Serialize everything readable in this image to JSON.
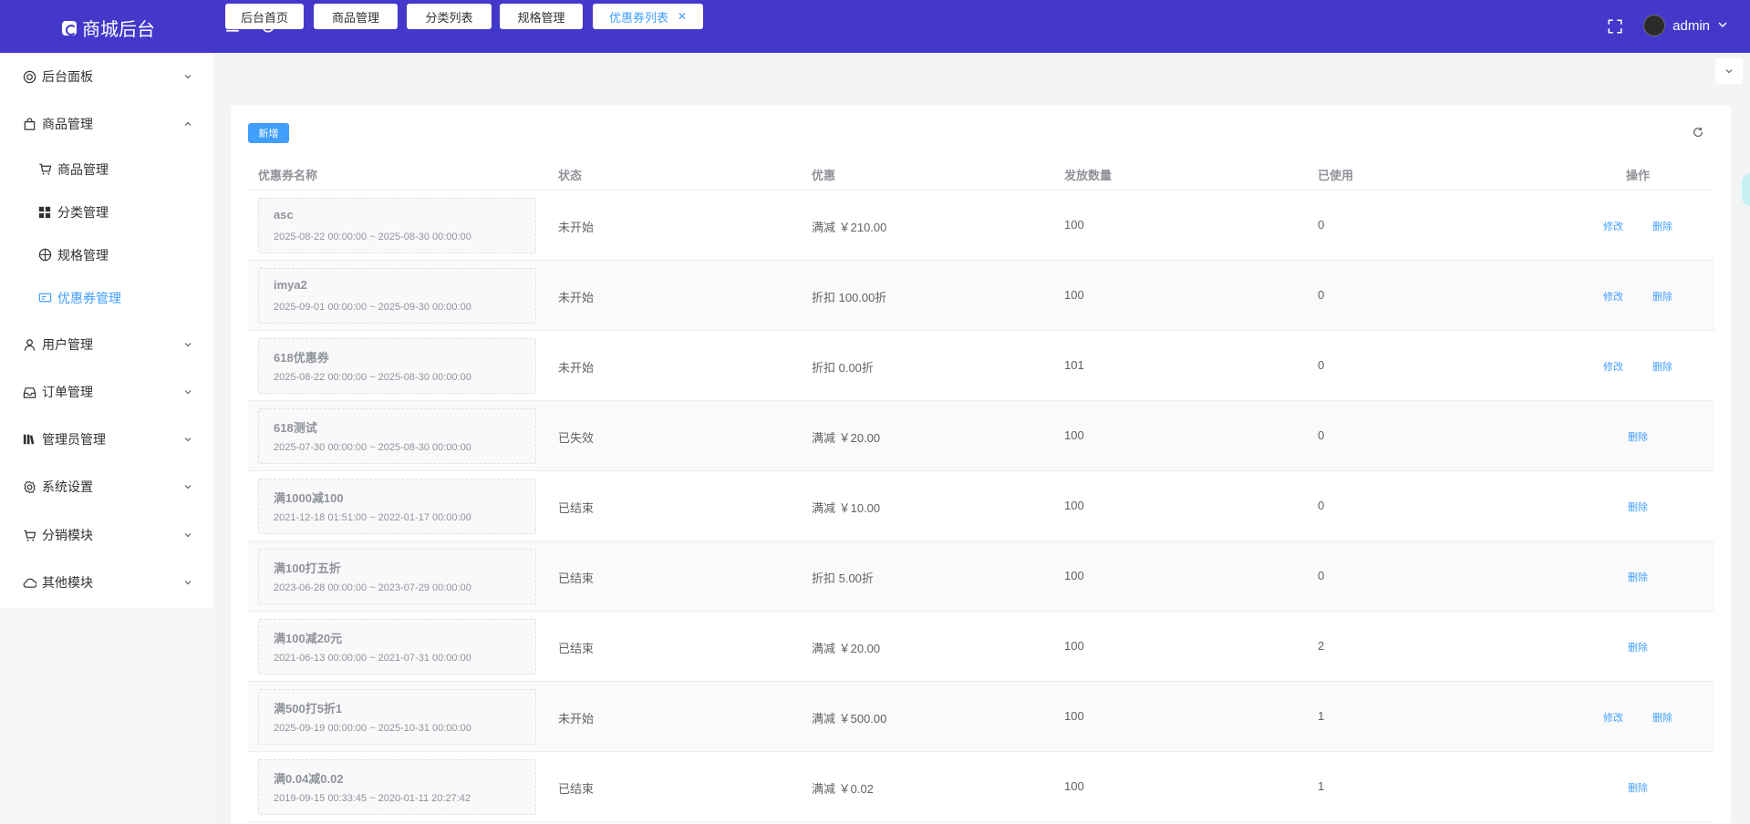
{
  "header": {
    "brand": "商城后台",
    "user": "admin"
  },
  "sidebar": {
    "items": [
      {
        "label": "后台面板"
      },
      {
        "label": "商品管理"
      },
      {
        "label": "用户管理"
      },
      {
        "label": "订单管理"
      },
      {
        "label": "管理员管理"
      },
      {
        "label": "系统设置"
      },
      {
        "label": "分销模块"
      },
      {
        "label": "其他模块"
      }
    ],
    "sub": [
      {
        "label": "商品管理"
      },
      {
        "label": "分类管理"
      },
      {
        "label": "规格管理"
      },
      {
        "label": "优惠券管理"
      }
    ]
  },
  "tabs": [
    {
      "label": "后台首页"
    },
    {
      "label": "商品管理"
    },
    {
      "label": "分类列表"
    },
    {
      "label": "规格管理"
    },
    {
      "label": "优惠券列表"
    }
  ],
  "toolbar": {
    "add_label": "新增"
  },
  "table": {
    "headers": [
      "优惠券名称",
      "状态",
      "优惠",
      "发放数量",
      "已使用",
      "操作"
    ],
    "edit_label": "修改",
    "delete_label": "删除",
    "rows": [
      {
        "name": "asc",
        "range": "2025-08-22 00:00:00 ~ 2025-08-30 00:00:00",
        "status": "未开始",
        "discount": "满减 ￥210.00",
        "qty": "100",
        "used": "0",
        "editable": true
      },
      {
        "name": "imya2",
        "range": "2025-09-01 00:00:00 ~ 2025-09-30 00:00:00",
        "status": "未开始",
        "discount": "折扣 100.00折",
        "qty": "100",
        "used": "0",
        "editable": true
      },
      {
        "name": "618优惠券",
        "range": "2025-08-22 00:00:00 ~ 2025-08-30 00:00:00",
        "status": "未开始",
        "discount": "折扣 0.00折",
        "qty": "101",
        "used": "0",
        "editable": true
      },
      {
        "name": "618测试",
        "range": "2025-07-30 00:00:00 ~ 2025-08-30 00:00:00",
        "status": "已失效",
        "discount": "满减 ￥20.00",
        "qty": "100",
        "used": "0",
        "editable": false
      },
      {
        "name": "满1000减100",
        "range": "2021-12-18 01:51:00 ~ 2022-01-17 00:00:00",
        "status": "已结束",
        "discount": "满减 ￥10.00",
        "qty": "100",
        "used": "0",
        "editable": false
      },
      {
        "name": "满100打五折",
        "range": "2023-06-28 00:00:00 ~ 2023-07-29 00:00:00",
        "status": "已结束",
        "discount": "折扣 5.00折",
        "qty": "100",
        "used": "0",
        "editable": false
      },
      {
        "name": "满100减20元",
        "range": "2021-06-13 00:00:00 ~ 2021-07-31 00:00:00",
        "status": "已结束",
        "discount": "满减 ￥20.00",
        "qty": "100",
        "used": "2",
        "editable": false
      },
      {
        "name": "满500打5折1",
        "range": "2025-09-19 00:00:00 ~ 2025-10-31 00:00:00",
        "status": "未开始",
        "discount": "满减 ￥500.00",
        "qty": "100",
        "used": "1",
        "editable": true
      },
      {
        "name": "满0.04减0.02",
        "range": "2019-09-15 00:33:45 ~ 2020-01-11 20:27:42",
        "status": "已结束",
        "discount": "满减 ￥0.02",
        "qty": "100",
        "used": "1",
        "editable": false
      }
    ]
  },
  "colors": {
    "header_bg": "#4338ca",
    "accent": "#409eff"
  }
}
